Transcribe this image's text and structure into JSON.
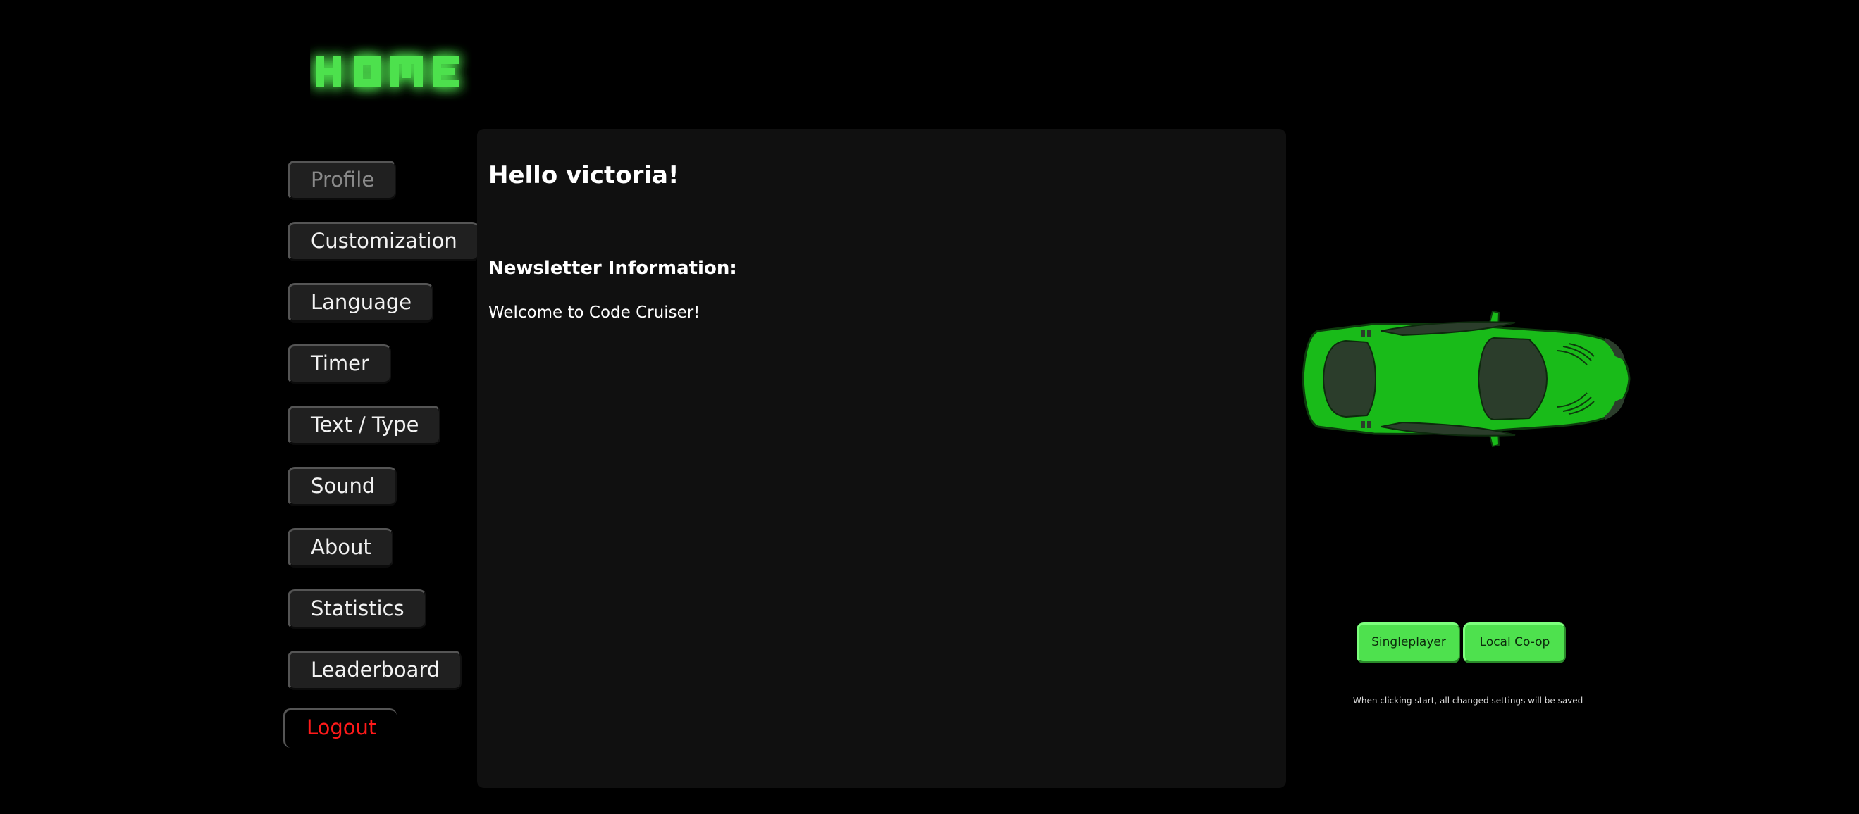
{
  "header": {
    "title": "HOME",
    "title_color": "#4ee14e"
  },
  "menu": {
    "items": [
      {
        "label": "Profile",
        "state": "disabled"
      },
      {
        "label": "Customization",
        "state": "enabled"
      },
      {
        "label": "Language",
        "state": "enabled"
      },
      {
        "label": "Timer",
        "state": "enabled"
      },
      {
        "label": "Text / Type",
        "state": "enabled"
      },
      {
        "label": "Sound",
        "state": "enabled"
      },
      {
        "label": "About",
        "state": "enabled"
      },
      {
        "label": "Statistics",
        "state": "enabled"
      },
      {
        "label": "Leaderboard",
        "state": "enabled"
      }
    ],
    "logout_label": "Logout",
    "logout_color": "#ff1a1a"
  },
  "main": {
    "greeting": "Hello victoria!",
    "newsletter_heading": "Newsletter Information:",
    "newsletter_body": "Welcome to Code Cruiser!"
  },
  "car": {
    "icon": "race-car-icon",
    "color": "#19bb19"
  },
  "modes": {
    "singleplayer_label": "Singleplayer",
    "coop_label": "Local Co-op",
    "button_color": "#4ee14e"
  },
  "note": "When clicking start, all changed settings will be saved",
  "colors": {
    "background": "#000000",
    "panel": "#101010",
    "button": "#202020"
  }
}
